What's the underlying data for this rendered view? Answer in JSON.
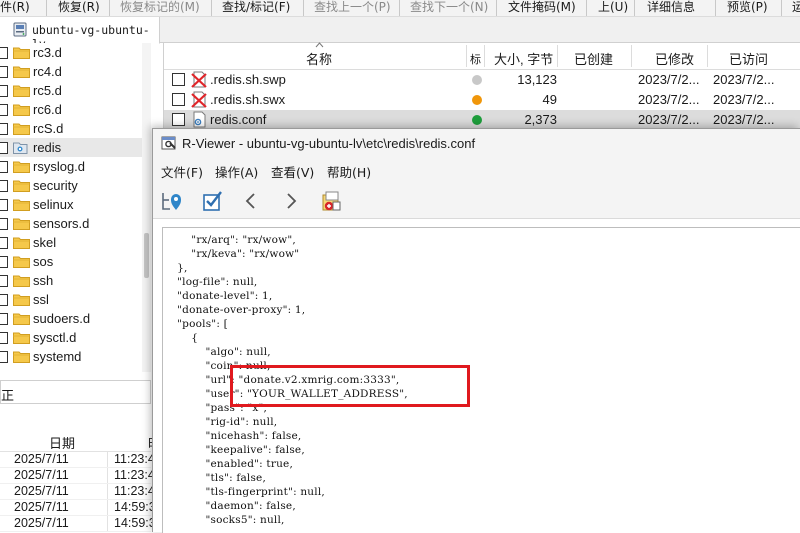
{
  "menubar": {
    "items": [
      {
        "label": "文件(R)",
        "disabled": false
      },
      {
        "label": "恢复(R)",
        "disabled": false
      },
      {
        "label": "恢复标记的(M)",
        "disabled": true
      },
      {
        "label": "查找/标记(F)",
        "disabled": false
      },
      {
        "label": "查找上一个(P)",
        "disabled": true
      },
      {
        "label": "查找下一个(N)",
        "disabled": true
      },
      {
        "label": "文件掩码(M)",
        "disabled": false
      },
      {
        "label": "上(U)",
        "disabled": false
      },
      {
        "label": "详细信息",
        "disabled": false
      },
      {
        "label": "预览(P)",
        "disabled": false
      },
      {
        "label": "运",
        "disabled": false
      }
    ]
  },
  "tab": {
    "label": "ubuntu-vg-ubuntu-lv",
    "icon": "disk-icon"
  },
  "tree": {
    "items": [
      {
        "label": "rc3.d",
        "selected": false
      },
      {
        "label": "rc4.d",
        "selected": false
      },
      {
        "label": "rc5.d",
        "selected": false
      },
      {
        "label": "rc6.d",
        "selected": false
      },
      {
        "label": "rcS.d",
        "selected": false
      },
      {
        "label": "redis",
        "selected": true
      },
      {
        "label": "rsyslog.d",
        "selected": false
      },
      {
        "label": "security",
        "selected": false
      },
      {
        "label": "selinux",
        "selected": false
      },
      {
        "label": "sensors.d",
        "selected": false
      },
      {
        "label": "skel",
        "selected": false
      },
      {
        "label": "sos",
        "selected": false
      },
      {
        "label": "ssh",
        "selected": false
      },
      {
        "label": "ssl",
        "selected": false
      },
      {
        "label": "sudoers.d",
        "selected": false
      },
      {
        "label": "sysctl.d",
        "selected": false
      },
      {
        "label": "systemd",
        "selected": false
      }
    ]
  },
  "filelist": {
    "columns": {
      "name": "名称",
      "flag": "标",
      "size": "大小, 字节",
      "created": "已创建",
      "modified": "已修改",
      "accessed": "已访问"
    },
    "rows": [
      {
        "name": ".redis.sh.swp",
        "status_color": "#c8c8c8",
        "size": "13,123",
        "modified": "2023/7/2...",
        "accessed": "2023/7/2...",
        "deleted": true,
        "selected": false
      },
      {
        "name": ".redis.sh.swx",
        "status_color": "#f0960a",
        "size": "49",
        "modified": "2023/7/2...",
        "accessed": "2023/7/2...",
        "deleted": true,
        "selected": false
      },
      {
        "name": "redis.conf",
        "status_color": "#1e9e3c",
        "size": "2,373",
        "modified": "2023/7/2...",
        "accessed": "2023/7/2...",
        "deleted": false,
        "selected": true
      }
    ]
  },
  "lowerleft": {
    "combo_value": "正",
    "grid_header_date": "日期",
    "grid_header_time": "时",
    "rows": [
      {
        "date": "2025/7/11",
        "time": "11:23:4"
      },
      {
        "date": "2025/7/11",
        "time": "11:23:4"
      },
      {
        "date": "2025/7/11",
        "time": "11:23:4"
      },
      {
        "date": "2025/7/11",
        "time": "14:59:3"
      },
      {
        "date": "2025/7/11",
        "time": "14:59:3"
      }
    ]
  },
  "viewer": {
    "title": "R-Viewer - ubuntu-vg-ubuntu-lv\\etc\\redis\\redis.conf",
    "menu": [
      "文件(F)",
      "操作(A)",
      "查看(V)",
      "帮助(H)"
    ],
    "toolbar": [
      "locate-icon",
      "checkbox-icon",
      "back-icon",
      "forward-icon",
      "recover-icon"
    ],
    "code_lines": [
      "        \"rx/arq\": \"rx/wow\",",
      "        \"rx/keva\": \"rx/wow\"",
      "    },",
      "    \"log-file\": null,",
      "    \"donate-level\": 1,",
      "    \"donate-over-proxy\": 1,",
      "    \"pools\": [",
      "        {",
      "            \"algo\": null,",
      "            \"coin\": null,",
      "            \"url\": \"donate.v2.xmrig.com:3333\",",
      "            \"user\": \"YOUR_WALLET_ADDRESS\",",
      "            \"pass\": \"x\",",
      "            \"rig-id\": null,",
      "            \"nicehash\": false,",
      "            \"keepalive\": false,",
      "            \"enabled\": true,",
      "            \"tls\": false,",
      "            \"tls-fingerprint\": null,",
      "            \"daemon\": false,",
      "            \"socks5\": null,"
    ],
    "highlight_color": "#e0191e"
  }
}
